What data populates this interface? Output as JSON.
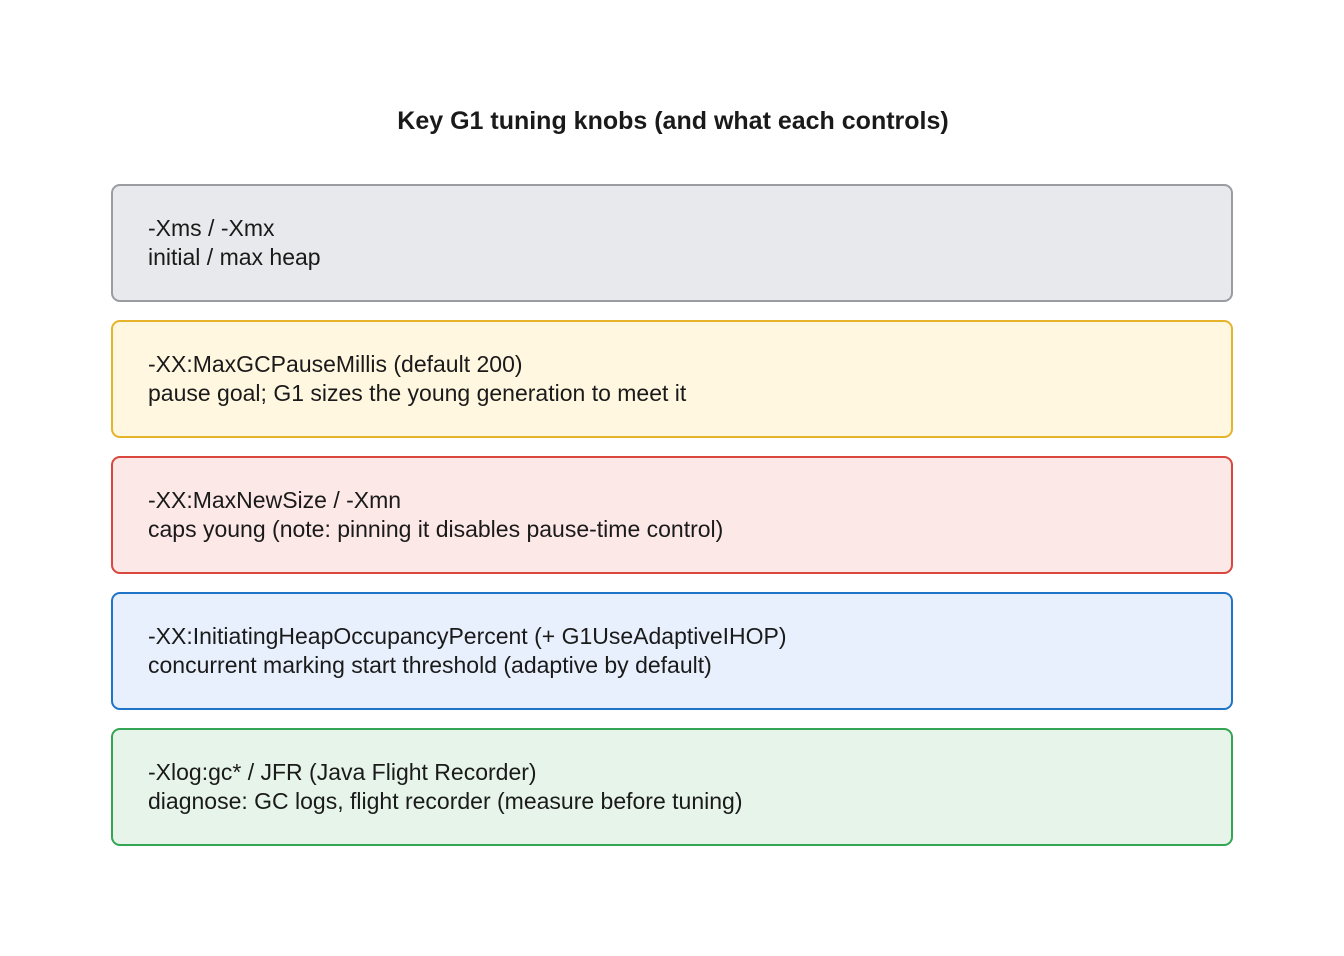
{
  "title": "Key G1 tuning knobs (and what each controls)",
  "knobs": [
    {
      "flag": "-Xms / -Xmx",
      "description": "initial / max heap",
      "fill": "#e8e9ec",
      "border": "#9a9ca2"
    },
    {
      "flag": "-XX:MaxGCPauseMillis (default 200)",
      "description": "pause goal; G1 sizes the young generation to meet it",
      "fill": "#fff7e0",
      "border": "#e6b42a"
    },
    {
      "flag": "-XX:MaxNewSize / -Xmn",
      "description": "caps young (note: pinning it disables pause-time control)",
      "fill": "#fce8e6",
      "border": "#d9473f"
    },
    {
      "flag": "-XX:InitiatingHeapOccupancyPercent (+ G1UseAdaptiveIHOP)",
      "description": "concurrent marking start threshold (adaptive by default)",
      "fill": "#e8f0fd",
      "border": "#1f74c8"
    },
    {
      "flag": "-Xlog:gc* / JFR (Java Flight Recorder)",
      "description": "diagnose: GC logs, flight recorder (measure before tuning)",
      "fill": "#e6f4ea",
      "border": "#34a553"
    }
  ]
}
